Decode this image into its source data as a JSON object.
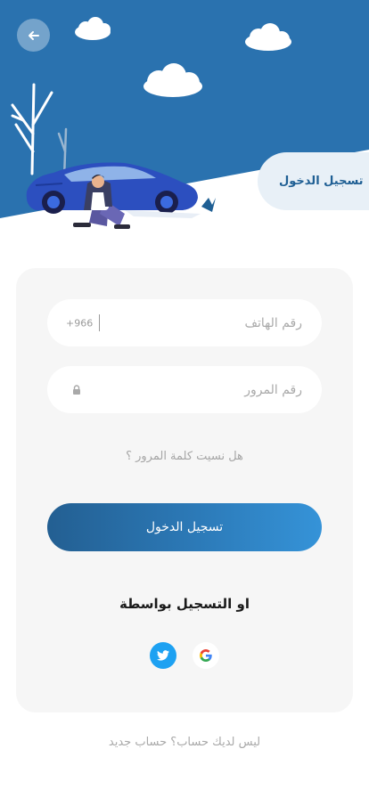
{
  "header": {
    "login_tab_label": "تسجيل الدخول"
  },
  "icons": {
    "back": "back-arrow-icon",
    "lock": "lock-icon",
    "twitter": "twitter-icon",
    "google": "google-icon"
  },
  "form": {
    "phone": {
      "placeholder": "رقم الهاتف",
      "country_code": "+966"
    },
    "password": {
      "placeholder": "رقم المرور"
    },
    "forgot_password": "هل نسيت كلمة المرور ؟",
    "login_button": "تسجيل الدخول",
    "social_label": "او  التسجيل بواسطة"
  },
  "footer": {
    "signup_text": "ليس لديك  حساب؟ حساب جديد"
  },
  "colors": {
    "primary": "#2a72af",
    "primary_dark": "#235f92",
    "card_bg": "#f6f6f6",
    "tab_bg": "#e8f0f7",
    "twitter": "#1da1f2"
  }
}
